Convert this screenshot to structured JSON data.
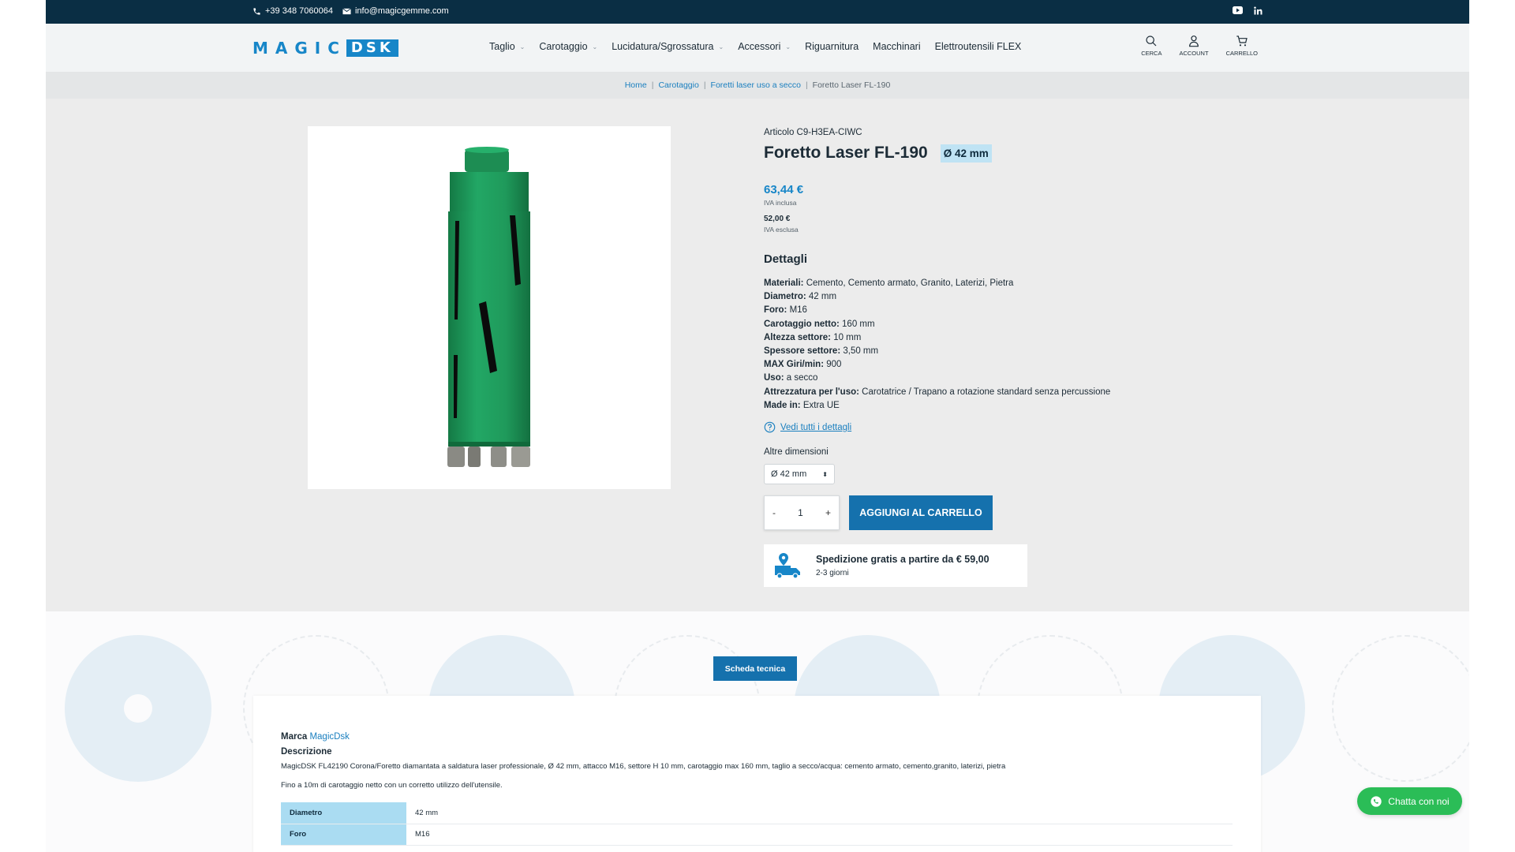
{
  "topbar": {
    "phone": "+39 348 7060064",
    "email": "info@magicgemme.com",
    "social": [
      "youtube-icon",
      "linkedin-icon"
    ]
  },
  "header": {
    "logo_part1": "MAGIC",
    "logo_part2": "DSK",
    "nav": [
      {
        "label": "Taglio",
        "has_dropdown": true
      },
      {
        "label": "Carotaggio",
        "has_dropdown": true
      },
      {
        "label": "Lucidatura/Sgrossatura",
        "has_dropdown": true
      },
      {
        "label": "Accessori",
        "has_dropdown": true
      },
      {
        "label": "Riguarnitura",
        "has_dropdown": false
      },
      {
        "label": "Macchinari",
        "has_dropdown": false
      },
      {
        "label": "Elettroutensili FLEX",
        "has_dropdown": false
      }
    ],
    "actions": {
      "search": "CERCA",
      "account": "ACCOUNT",
      "cart": "CARRELLO"
    }
  },
  "breadcrumb": [
    "Home",
    "Carotaggio",
    "Foretti laser uso a secco",
    "Foretto Laser FL-190"
  ],
  "product": {
    "sku": "Articolo C9-H3EA-CIWC",
    "title": "Foretto Laser FL-190",
    "size_badge": "Ø 42 mm",
    "price": "63,44 €",
    "price_note": "IVA inclusa",
    "price_ex": "52,00 €",
    "price_ex_note": "IVA esclusa",
    "details_title": "Dettagli",
    "details": [
      {
        "key": "Materiali:",
        "value": " Cemento, Cemento armato, Granito, Laterizi, Pietra"
      },
      {
        "key": "Diametro:",
        "value": " 42 mm"
      },
      {
        "key": "Foro:",
        "value": " M16"
      },
      {
        "key": "Carotaggio netto:",
        "value": " 160 mm"
      },
      {
        "key": "Altezza settore:",
        "value": " 10 mm"
      },
      {
        "key": "Spessore settore:",
        "value": " 3,50 mm"
      },
      {
        "key": "MAX Giri/min:",
        "value": " 900"
      },
      {
        "key": "Uso:",
        "value": " a secco"
      },
      {
        "key": "Attrezzatura per l'uso:",
        "value": " Carotatrice / Trapano a rotazione standard senza percussione"
      },
      {
        "key": "Made in:",
        "value": " Extra UE"
      }
    ],
    "more_details": "Vedi tutti i dettagli",
    "alt_sizes_label": "Altre dimensioni",
    "alt_size_selected": "Ø 42 mm",
    "qty_minus": "-",
    "qty": "1",
    "qty_plus": "+",
    "add_to_cart": "AGGIUNGI AL CARRELLO",
    "shipping_title": "Spedizione gratis a partire da € 59,00",
    "shipping_sub": "2-3 giorni"
  },
  "tech": {
    "tab": "Scheda tecnica",
    "brand_key": "Marca",
    "brand_value": "MagicDsk",
    "desc_title": "Descrizione",
    "desc": "MagicDSK FL42190 Corona/Foretto diamantata a saldatura laser professionale, Ø 42 mm, attacco M16, settore H 10 mm, carotaggio max 160 mm, taglio a secco/acqua: cemento armato, cemento,granito, laterizi, pietra",
    "desc2": "Fino a 10m di carotaggio netto con un corretto utilizzo dell'utensile.",
    "specs": [
      {
        "key": "Diametro",
        "value": "42 mm"
      },
      {
        "key": "Foro",
        "value": "M16"
      }
    ]
  },
  "chat": {
    "label": "Chatta con noi"
  },
  "colors": {
    "topbar": "#0a2e44",
    "accent": "#1786c8",
    "button": "#1571ad",
    "product_green": "#1f9a5b",
    "chat_green": "#2bbd57"
  }
}
